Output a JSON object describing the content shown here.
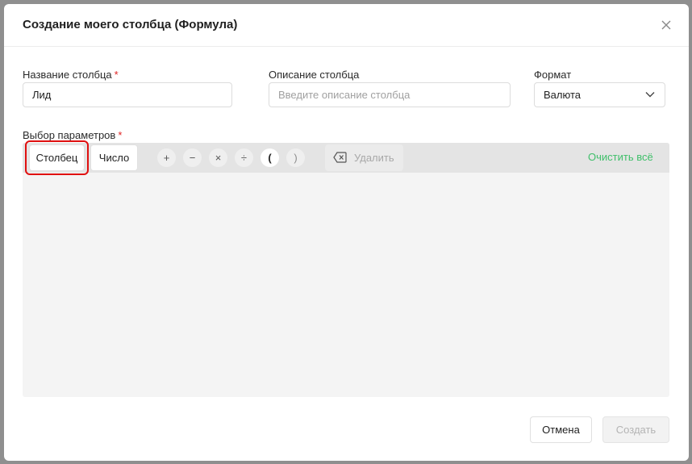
{
  "modal": {
    "title": "Создание моего столбца (Формула)",
    "close_icon": "close-icon"
  },
  "fields": {
    "column_name": {
      "label": "Название столбца",
      "required_mark": "*",
      "value": "Лид"
    },
    "column_description": {
      "label": "Описание столбца",
      "placeholder": "Введите описание столбца",
      "value": ""
    },
    "format": {
      "label": "Формат",
      "selected": "Валюта",
      "icon": "chevron-down-icon"
    }
  },
  "parameters": {
    "label": "Выбор параметров",
    "required_mark": "*",
    "toolbar": {
      "column_button": "Столбец",
      "number_button": "Число",
      "operators": [
        {
          "name": "plus-operator",
          "symbol": "+"
        },
        {
          "name": "minus-operator",
          "symbol": "−"
        },
        {
          "name": "multiply-operator",
          "symbol": "×"
        },
        {
          "name": "divide-operator",
          "symbol": "÷"
        },
        {
          "name": "open-paren-operator",
          "symbol": "("
        },
        {
          "name": "close-paren-operator",
          "symbol": ")"
        }
      ],
      "delete_button": "Удалить",
      "delete_icon": "backspace-icon",
      "clear_all": "Очистить всё"
    }
  },
  "footer": {
    "cancel": "Отмена",
    "create": "Создать"
  },
  "colors": {
    "accent_green": "#3fbf6a",
    "required_red": "#e02424",
    "highlight_red": "#e01010"
  }
}
